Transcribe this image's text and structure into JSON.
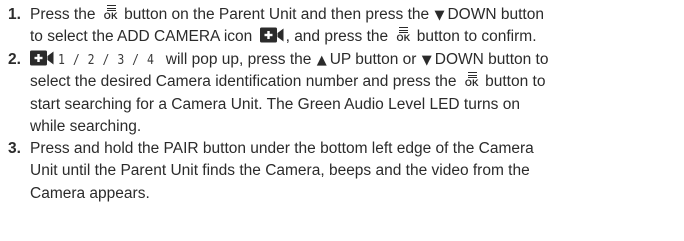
{
  "steps": [
    {
      "number": "1.",
      "lines": [
        {
          "seg1": "Press the",
          "seg2": "button on the Parent Unit and then press the",
          "seg3": "DOWN button"
        },
        {
          "seg1": "to select the ADD CAMERA icon",
          "seg2": ", and press the",
          "seg3": "button to confirm."
        }
      ]
    },
    {
      "number": "2.",
      "lines": [
        {
          "seg1": "1 / 2 / 3 / 4",
          "seg2": "will pop up, press the",
          "seg3": "UP button or",
          "seg4": "DOWN button to"
        },
        {
          "seg1": "select the desired Camera identification number and press the",
          "seg2": "button to"
        },
        {
          "text": "start searching for a Camera Unit. The Green Audio Level LED turns on"
        },
        {
          "text": "while searching."
        }
      ]
    },
    {
      "number": "3.",
      "lines": [
        {
          "text": "Press and hold the PAIR button under the bottom left edge of the Camera"
        },
        {
          "text": "Unit until the Parent Unit finds the Camera, beeps and the video from the"
        },
        {
          "text": "Camera appears."
        }
      ]
    }
  ],
  "icons": {
    "ok": "ok-menu-icon",
    "down": "down-arrow-icon",
    "up": "up-arrow-icon",
    "add_camera": "add-camera-icon"
  },
  "glyphs": {
    "down": "▼",
    "up": "▲",
    "ok": "OK"
  }
}
